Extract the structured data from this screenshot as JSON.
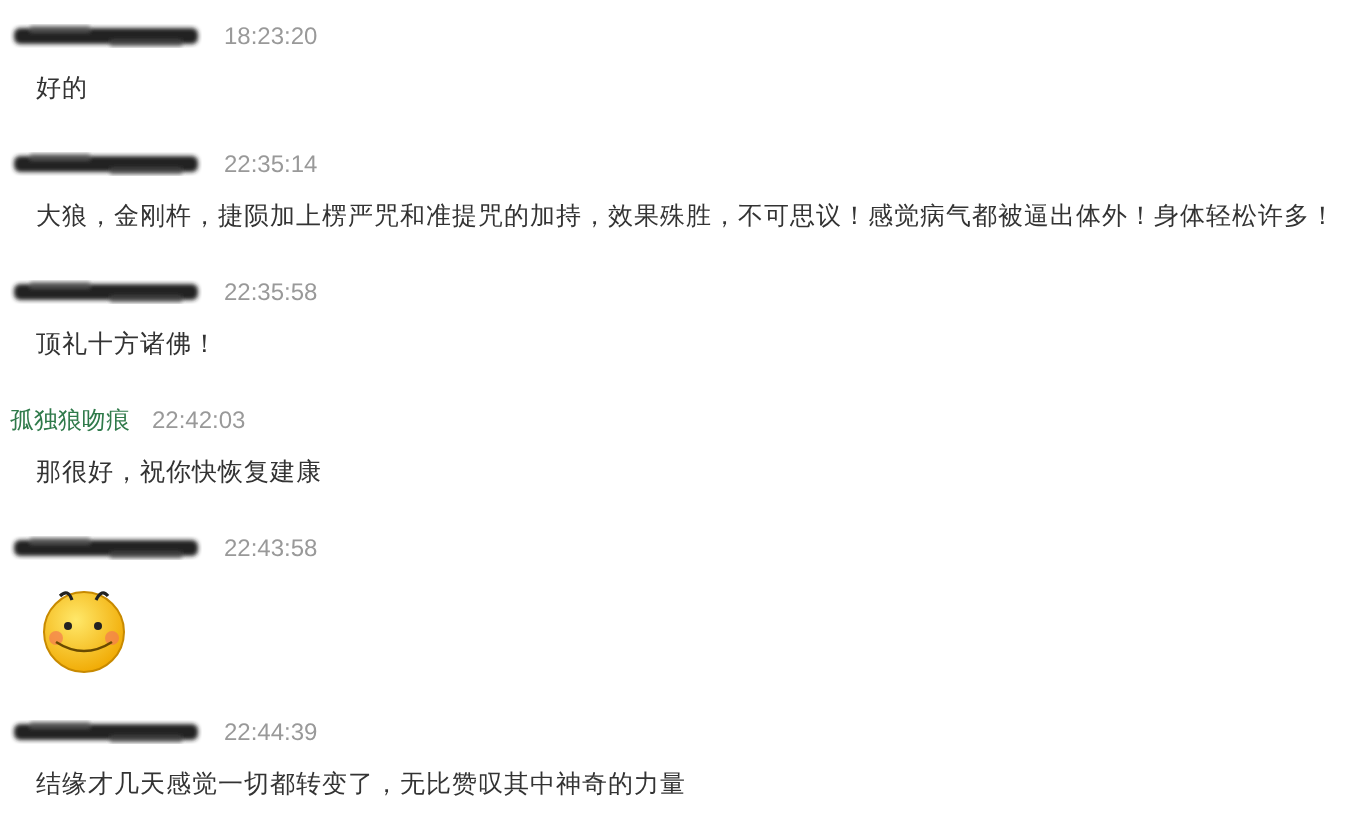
{
  "messages": [
    {
      "sender": {
        "kind": "redacted"
      },
      "time": "18:23:20",
      "content": {
        "kind": "text",
        "text": "好的"
      }
    },
    {
      "sender": {
        "kind": "redacted"
      },
      "time": "22:35:14",
      "content": {
        "kind": "text",
        "text": "大狼，金刚杵，捷陨加上楞严咒和准提咒的加持，效果殊胜，不可思议！感觉病气都被逼出体外！身体轻松许多！"
      }
    },
    {
      "sender": {
        "kind": "redacted"
      },
      "time": "22:35:58",
      "content": {
        "kind": "text",
        "text": "顶礼十方诸佛！"
      }
    },
    {
      "sender": {
        "kind": "named",
        "name": "孤独狼吻痕"
      },
      "time": "22:42:03",
      "content": {
        "kind": "text",
        "text": "那很好，祝你快恢复建康"
      }
    },
    {
      "sender": {
        "kind": "redacted"
      },
      "time": "22:43:58",
      "content": {
        "kind": "emoji"
      }
    },
    {
      "sender": {
        "kind": "redacted"
      },
      "time": "22:44:39",
      "content": {
        "kind": "text",
        "text": "结缘才几天感觉一切都转变了，无比赞叹其中神奇的力量"
      }
    }
  ]
}
